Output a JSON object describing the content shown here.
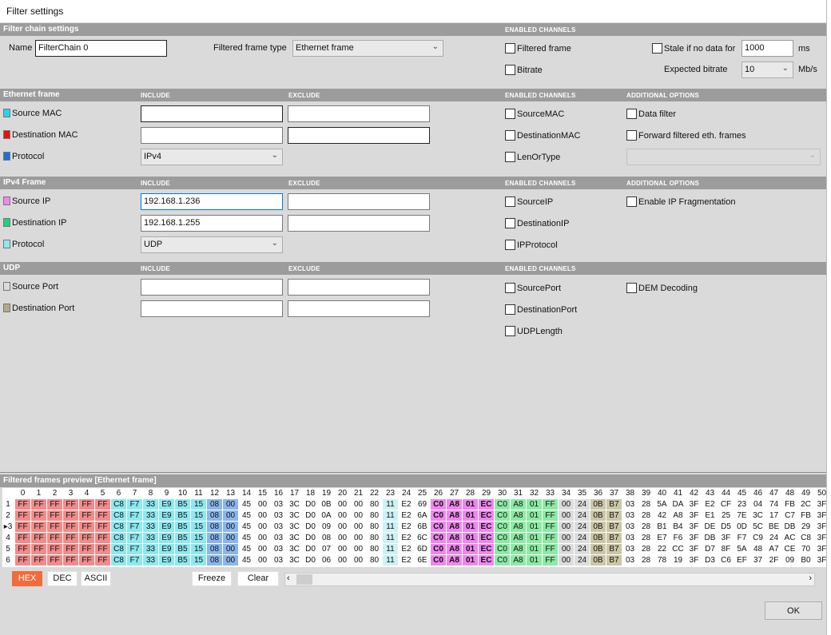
{
  "window": {
    "title": "Filter settings"
  },
  "chain": {
    "header": "Filter chain settings",
    "enabled_channels": "ENABLED CHANNELS",
    "name_label": "Name",
    "name_value": "FilterChain 0",
    "frame_type_label": "Filtered frame type",
    "frame_type_value": "Ethernet frame",
    "ch_filtered": "Filtered frame",
    "ch_bitrate": "Bitrate",
    "stale_label": "Stale if no data for",
    "stale_value": "1000",
    "stale_unit": "ms",
    "bitrate_label": "Expected bitrate",
    "bitrate_value": "10",
    "bitrate_unit": "Mb/s"
  },
  "eth": {
    "header": "Ethernet frame",
    "include": "INCLUDE",
    "exclude": "EXCLUDE",
    "enabled": "ENABLED CHANNELS",
    "additional": "ADDITIONAL OPTIONS",
    "src_mac": "Source MAC",
    "dst_mac": "Destination MAC",
    "protocol": "Protocol",
    "protocol_value": "IPv4",
    "ch1": "SourceMAC",
    "ch2": "DestinationMAC",
    "ch3": "LenOrType",
    "opt1": "Data filter",
    "opt2": "Forward filtered eth. frames",
    "colors": {
      "src": "#27d5e8",
      "dst": "#e81010",
      "proto": "#1e6fd8"
    }
  },
  "ipv4": {
    "header": "IPv4 Frame",
    "include": "INCLUDE",
    "exclude": "EXCLUDE",
    "enabled": "ENABLED CHANNELS",
    "additional": "ADDITIONAL OPTIONS",
    "src_ip": "Source IP",
    "src_ip_value": "192.168.1.236",
    "dst_ip": "Destination IP",
    "dst_ip_value": "192.168.1.255",
    "protocol": "Protocol",
    "protocol_value": "UDP",
    "ch1": "SourceIP",
    "ch2": "DestinationIP",
    "ch3": "IPProtocol",
    "opt1": "Enable IP Fragmentation",
    "colors": {
      "src": "#ef87ef",
      "dst": "#1fd27a",
      "proto": "#8ee8f0"
    }
  },
  "udp": {
    "header": "UDP",
    "include": "INCLUDE",
    "exclude": "EXCLUDE",
    "enabled": "ENABLED CHANNELS",
    "src_port": "Source Port",
    "dst_port": "Destination Port",
    "ch1": "SourcePort",
    "ch2": "DestinationPort",
    "ch3": "UDPLength",
    "opt1": "DEM Decoding",
    "colors": {
      "src": "#dcdcdc",
      "dst": "#b3aa84"
    }
  },
  "preview": {
    "header": "Filtered frames preview [Ethernet frame]",
    "columns": [
      "0",
      "1",
      "2",
      "3",
      "4",
      "5",
      "6",
      "7",
      "8",
      "9",
      "10",
      "11",
      "12",
      "13",
      "14",
      "15",
      "16",
      "17",
      "18",
      "19",
      "20",
      "21",
      "22",
      "23",
      "24",
      "25",
      "26",
      "27",
      "28",
      "29",
      "30",
      "31",
      "32",
      "33",
      "34",
      "35",
      "36",
      "37",
      "38",
      "39",
      "40",
      "41",
      "42",
      "43",
      "44",
      "45",
      "46",
      "47",
      "48",
      "49",
      "50"
    ],
    "rows": [
      {
        "n": "1",
        "bytes": [
          "FF",
          "FF",
          "FF",
          "FF",
          "FF",
          "FF",
          "C8",
          "F7",
          "33",
          "E9",
          "B5",
          "15",
          "08",
          "00",
          "45",
          "00",
          "03",
          "3C",
          "D0",
          "0B",
          "00",
          "00",
          "80",
          "11",
          "E2",
          "69",
          "C0",
          "A8",
          "01",
          "EC",
          "C0",
          "A8",
          "01",
          "FF",
          "00",
          "24",
          "0B",
          "B7",
          "03",
          "28",
          "5A",
          "DA",
          "3F",
          "E2",
          "CF",
          "23",
          "04",
          "74",
          "FB",
          "2C",
          "3F"
        ]
      },
      {
        "n": "2",
        "bytes": [
          "FF",
          "FF",
          "FF",
          "FF",
          "FF",
          "FF",
          "C8",
          "F7",
          "33",
          "E9",
          "B5",
          "15",
          "08",
          "00",
          "45",
          "00",
          "03",
          "3C",
          "D0",
          "0A",
          "00",
          "00",
          "80",
          "11",
          "E2",
          "6A",
          "C0",
          "A8",
          "01",
          "EC",
          "C0",
          "A8",
          "01",
          "FF",
          "00",
          "24",
          "0B",
          "B7",
          "03",
          "28",
          "42",
          "A8",
          "3F",
          "E1",
          "25",
          "7E",
          "3C",
          "17",
          "C7",
          "FB",
          "3F"
        ]
      },
      {
        "n": "3",
        "bytes": [
          "FF",
          "FF",
          "FF",
          "FF",
          "FF",
          "FF",
          "C8",
          "F7",
          "33",
          "E9",
          "B5",
          "15",
          "08",
          "00",
          "45",
          "00",
          "03",
          "3C",
          "D0",
          "09",
          "00",
          "00",
          "80",
          "11",
          "E2",
          "6B",
          "C0",
          "A8",
          "01",
          "EC",
          "C0",
          "A8",
          "01",
          "FF",
          "00",
          "24",
          "0B",
          "B7",
          "03",
          "28",
          "B1",
          "B4",
          "3F",
          "DE",
          "D5",
          "0D",
          "5C",
          "BE",
          "DB",
          "29",
          "3F"
        ]
      },
      {
        "n": "4",
        "bytes": [
          "FF",
          "FF",
          "FF",
          "FF",
          "FF",
          "FF",
          "C8",
          "F7",
          "33",
          "E9",
          "B5",
          "15",
          "08",
          "00",
          "45",
          "00",
          "03",
          "3C",
          "D0",
          "08",
          "00",
          "00",
          "80",
          "11",
          "E2",
          "6C",
          "C0",
          "A8",
          "01",
          "EC",
          "C0",
          "A8",
          "01",
          "FF",
          "00",
          "24",
          "0B",
          "B7",
          "03",
          "28",
          "E7",
          "F6",
          "3F",
          "DB",
          "3F",
          "F7",
          "C9",
          "24",
          "AC",
          "C8",
          "3F"
        ]
      },
      {
        "n": "5",
        "bytes": [
          "FF",
          "FF",
          "FF",
          "FF",
          "FF",
          "FF",
          "C8",
          "F7",
          "33",
          "E9",
          "B5",
          "15",
          "08",
          "00",
          "45",
          "00",
          "03",
          "3C",
          "D0",
          "07",
          "00",
          "00",
          "80",
          "11",
          "E2",
          "6D",
          "C0",
          "A8",
          "01",
          "EC",
          "C0",
          "A8",
          "01",
          "FF",
          "00",
          "24",
          "0B",
          "B7",
          "03",
          "28",
          "22",
          "CC",
          "3F",
          "D7",
          "8F",
          "5A",
          "48",
          "A7",
          "CE",
          "70",
          "3F"
        ]
      },
      {
        "n": "6",
        "bytes": [
          "FF",
          "FF",
          "FF",
          "FF",
          "FF",
          "FF",
          "C8",
          "F7",
          "33",
          "E9",
          "B5",
          "15",
          "08",
          "00",
          "45",
          "00",
          "03",
          "3C",
          "D0",
          "06",
          "00",
          "00",
          "80",
          "11",
          "E2",
          "6E",
          "C0",
          "A8",
          "01",
          "EC",
          "C0",
          "A8",
          "01",
          "FF",
          "00",
          "24",
          "0B",
          "B7",
          "03",
          "28",
          "78",
          "19",
          "3F",
          "D3",
          "C6",
          "EF",
          "37",
          "2F",
          "09",
          "B0",
          "3F"
        ]
      }
    ],
    "highlight_colors": {
      "mac": "#f28b8b",
      "src_mac": "#8ee8f0",
      "proto": "#8ab6ec",
      "udp_chk": "#cdf1f5",
      "src_ip": "#ef87ef",
      "dst_ip": "#8ceaa4",
      "src_port": "#dcdcdc",
      "dst_port": "#cbc6a6"
    }
  },
  "buttons": {
    "hex": "HEX",
    "dec": "DEC",
    "ascii": "ASCII",
    "freeze": "Freeze",
    "clear": "Clear",
    "ok": "OK"
  }
}
